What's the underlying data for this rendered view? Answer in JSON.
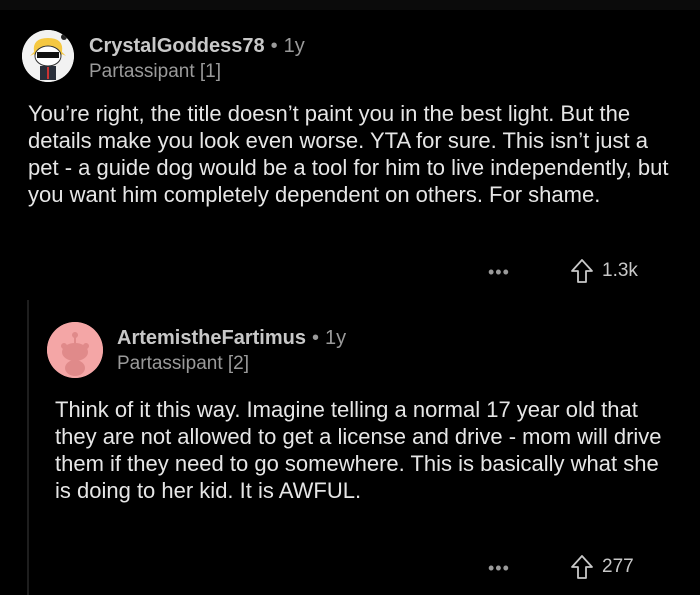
{
  "comments": [
    {
      "username": "CrystalGoddess78",
      "separator": "•",
      "age": "1y",
      "flair": "Partassipant [1]",
      "body": "You’re right, the title doesn’t paint you in the best light. But the details make you look even worse. YTA for sure. This isn’t just a pet - a guide dog would be a tool for him to live independently, but you want him completely dependent on others. For shame.",
      "more": "•••",
      "votes": "1.3k",
      "avatar_icon": "snoo-sunglasses-avatar-icon"
    },
    {
      "username": "ArtemistheFartimus",
      "separator": "•",
      "age": "1y",
      "flair": "Partassipant [2]",
      "body": "Think of it this way. Imagine telling a normal 17 year old that they are not allowed to get a license and drive - mom will drive them if they need to go somewhere. This is basically what she is doing to her kid. It is AWFUL.",
      "more": "•••",
      "votes": "277",
      "avatar_icon": "snoo-default-avatar-icon"
    }
  ],
  "colors": {
    "background": "#000000",
    "text": "#e6e6e6",
    "muted": "#9a9a9a",
    "avatar2_bg": "#f4a6a6"
  }
}
